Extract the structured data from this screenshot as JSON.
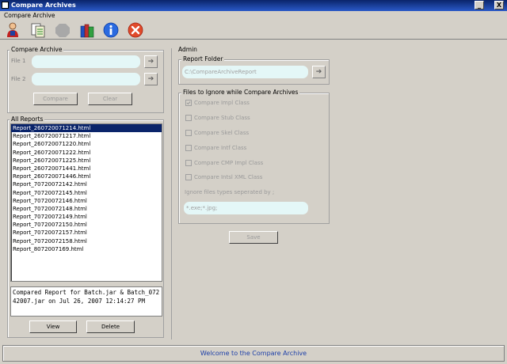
{
  "window": {
    "title": "Compare Archives",
    "controls": {
      "minimize": "_",
      "close": "X"
    }
  },
  "menu": {
    "items": [
      "Compare Archive"
    ]
  },
  "toolbar": {
    "icons": [
      "user-icon",
      "copy-documents-icon",
      "stop-icon",
      "books-icon",
      "info-icon",
      "exit-icon"
    ]
  },
  "compare_archive": {
    "title": "Compare Archive",
    "file1_label": "File 1",
    "file2_label": "File 2",
    "file1_value": "",
    "file2_value": "",
    "browse_glyph": "➔",
    "compare_button": "Compare",
    "clear_button": "Clear"
  },
  "all_reports": {
    "title": "All Reports",
    "items": [
      "Report_260720071214.html",
      "Report_260720071217.html",
      "Report_260720071220.html",
      "Report_260720071222.html",
      "Report_260720071225.html",
      "Report_260720071441.html",
      "Report_260720071446.html",
      "Report_70720072142.html",
      "Report_70720072145.html",
      "Report_70720072146.html",
      "Report_70720072148.html",
      "Report_70720072149.html",
      "Report_70720072150.html",
      "Report_70720072157.html",
      "Report_70720072158.html",
      "Report_8072007169.html"
    ],
    "selected_index": 0,
    "details": "Compared Report for Batch.jar & Batch_07242007.jar on Jul 26, 2007 12:14:27 PM",
    "view_button": "View",
    "delete_button": "Delete"
  },
  "admin": {
    "title": "Admin",
    "report_folder": {
      "title": "Report Folder",
      "value": "C:\\CompareArchiveReport"
    },
    "ignore": {
      "title": "Files to Ignore while Compare Archives",
      "options": [
        {
          "label": "Compare Impl Class",
          "checked": true
        },
        {
          "label": "Compare Stub Class",
          "checked": false
        },
        {
          "label": "Compare Skel Class",
          "checked": false
        },
        {
          "label": "Compare Intf Class",
          "checked": false
        },
        {
          "label": "Compare CMP Impl Class",
          "checked": false
        },
        {
          "label": "Compare Intsl XML Class",
          "checked": false
        }
      ],
      "types_label": "Ignore files types seperated by ;",
      "types_value": "*.exe;*.jpg;"
    },
    "save_button": "Save"
  },
  "status": {
    "message": "Welcome to the Compare Archive"
  },
  "colors": {
    "title_bar": "#0a246a",
    "selection": "#0a246a",
    "field_bg": "#e4f7f7",
    "status_text": "#1c3ea8"
  }
}
